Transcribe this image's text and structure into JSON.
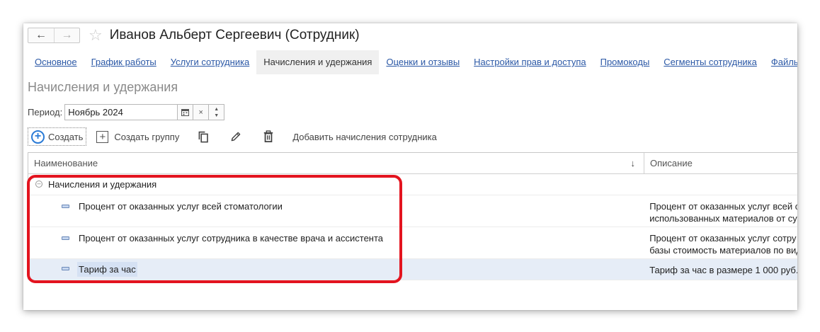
{
  "window": {
    "title": "Иванов Альберт Сергеевич (Сотрудник)",
    "back_icon": "arrow-left-icon",
    "forward_icon": "arrow-right-icon",
    "favorite_icon": "star-icon"
  },
  "tabs": [
    {
      "label": "Основное",
      "active": false
    },
    {
      "label": "График работы",
      "active": false
    },
    {
      "label": "Услуги сотрудника",
      "active": false
    },
    {
      "label": "Начисления и удержания",
      "active": true
    },
    {
      "label": "Оценки и отзывы",
      "active": false
    },
    {
      "label": "Настройки прав и доступа",
      "active": false
    },
    {
      "label": "Промокоды",
      "active": false
    },
    {
      "label": "Сегменты сотрудника",
      "active": false
    },
    {
      "label": "Файлы",
      "active": false
    }
  ],
  "section_title": "Начисления и удержания",
  "period": {
    "label": "Период:",
    "value": "Ноябрь 2024"
  },
  "toolbar": {
    "create_label": "Создать",
    "create_group_label": "Создать группу",
    "add_accruals_label": "Добавить начисления сотрудника"
  },
  "table": {
    "columns": {
      "name": "Наименование",
      "description": "Описание"
    },
    "group": {
      "name": "Начисления и удержания"
    },
    "rows": [
      {
        "name": "Процент от оказанных услуг всей стоматологии",
        "desc_line1": "Процент от оказанных услуг всей с",
        "desc_line2": "использованных материалов от су"
      },
      {
        "name": "Процент от оказанных услуг сотрудника в качестве врача и ассистента",
        "desc_line1": "Процент от оказанных услуг сотру",
        "desc_line2": "базы стоимость материалов по вид"
      },
      {
        "name": "Тариф за час",
        "desc_line1": "Тариф за час в размере 1 000 руб.",
        "desc_line2": ""
      }
    ]
  },
  "colors": {
    "link": "#2b58a6",
    "accent": "#2b7bd6",
    "annotation": "#e3141f",
    "selected_row": "#e6edf7"
  }
}
